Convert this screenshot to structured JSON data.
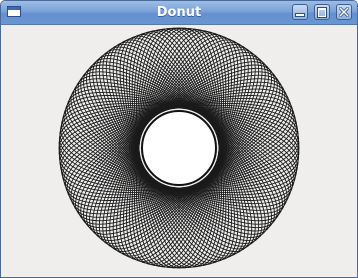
{
  "window": {
    "title": "Donut",
    "buttons": {
      "minimize": "minimize-icon",
      "maximize": "maximize-icon",
      "close": "close-icon"
    }
  },
  "drawing": {
    "shape": "donut",
    "background": "#efeeed",
    "stroke_color": "#1a1a1a",
    "inner_fill": "#ffffff",
    "ellipse_count": 36
  }
}
